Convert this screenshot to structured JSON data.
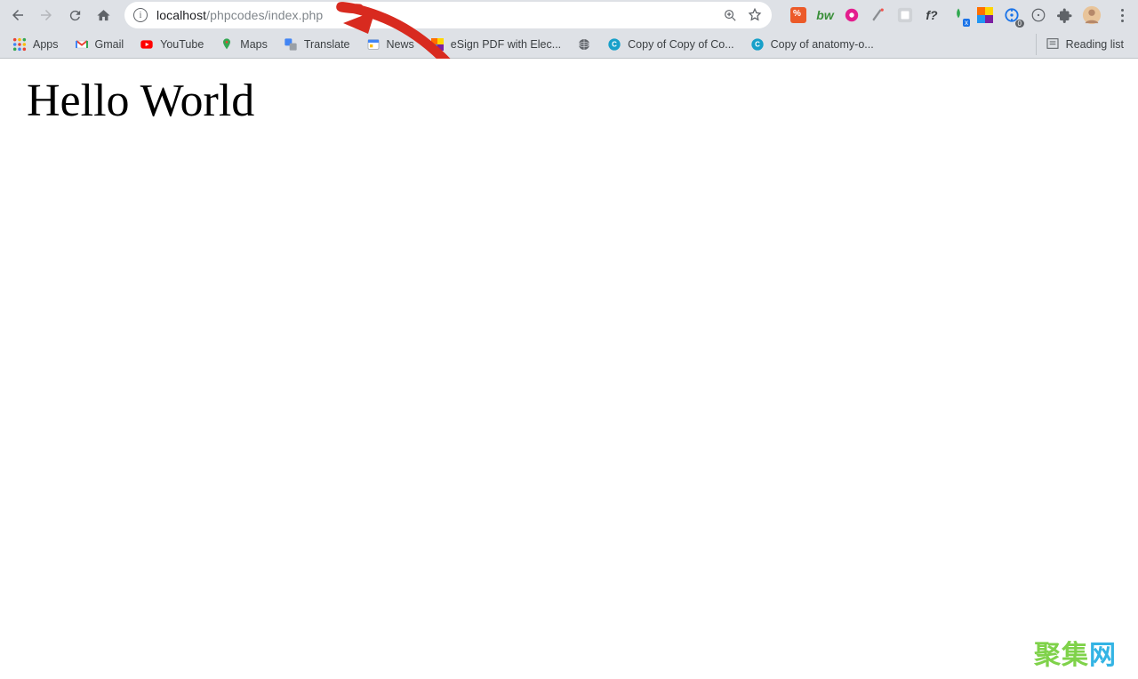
{
  "omnibox": {
    "host": "localhost",
    "path": "/phpcodes/index.php"
  },
  "bookmarks": {
    "apps": "Apps",
    "gmail": "Gmail",
    "youtube": "YouTube",
    "maps": "Maps",
    "translate": "Translate",
    "news": "News",
    "esign": "eSign PDF with Elec...",
    "copy1": "Copy of Copy of Co...",
    "copy2": "Copy of anatomy-o...",
    "reading": "Reading list"
  },
  "extensions": {
    "badge0": "0",
    "fq": "f?"
  },
  "page": {
    "heading": "Hello World"
  },
  "watermark": {
    "a": "聚",
    "b": "集",
    "c": "网"
  }
}
